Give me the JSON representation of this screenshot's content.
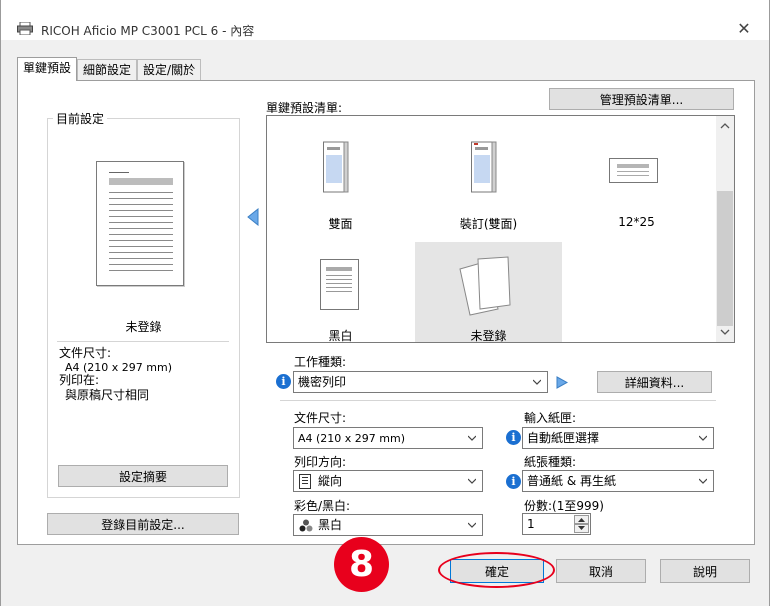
{
  "window": {
    "title": "RICOH Aficio MP C3001 PCL 6 - 內容",
    "close_glyph": "✕"
  },
  "tabs": [
    "單鍵預設",
    "細節設定",
    "設定/關於"
  ],
  "manage_button": "管理預設清單...",
  "current_settings": {
    "group_label": "目前設定",
    "preview_caption": "未登錄",
    "paper_size_label": "文件尺寸:",
    "paper_size_value": "A4 (210 x 297 mm)",
    "print_on_label": "列印在:",
    "print_on_value": "與原稿尺寸相同",
    "summary_button": "設定摘要",
    "register_button": "登錄目前設定..."
  },
  "preset_list": {
    "label": "單鍵預設清單:",
    "items": [
      {
        "label": "雙面",
        "icon": "duplex-page-icon"
      },
      {
        "label": "裝訂(雙面)",
        "icon": "staple-duplex-page-icon"
      },
      {
        "label": "12*25",
        "icon": "landscape-page-icon"
      },
      {
        "label": "黑白",
        "icon": "bw-page-icon"
      },
      {
        "label": "未登錄",
        "icon": "unregistered-pages-icon",
        "selected": true
      }
    ]
  },
  "job_type": {
    "label": "工作種類:",
    "value": "機密列印",
    "details_button": "詳細資料..."
  },
  "paper_size": {
    "label": "文件尺寸:",
    "value": "A4 (210 x 297 mm)"
  },
  "input_tray": {
    "label": "輸入紙匣:",
    "value": "自動紙匣選擇"
  },
  "orientation": {
    "label": "列印方向:",
    "value": "縱向"
  },
  "paper_type": {
    "label": "紙張種類:",
    "value": "普通紙 & 再生紙"
  },
  "color_mode": {
    "label": "彩色/黑白:",
    "value": "黑白"
  },
  "copies": {
    "label": "份數:(1至999)",
    "value": "1"
  },
  "footer": {
    "step_number": "8",
    "ok_button": "確定",
    "cancel_button": "取消",
    "help_button": "說明"
  },
  "colors": {
    "accent": "#0078d7",
    "annotation_red": "#e8001c",
    "info_blue": "#1a6fd1"
  }
}
